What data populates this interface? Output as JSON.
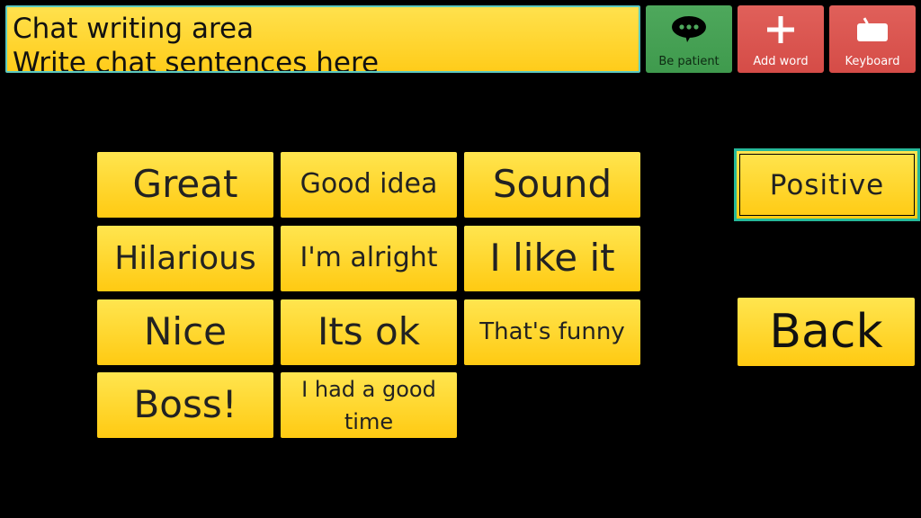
{
  "chat": {
    "title": "Chat writing area",
    "placeholder": "Write chat sentences here"
  },
  "toolbar": {
    "patient_label": "Be patient",
    "add_word_label": "Add word",
    "keyboard_label": "Keyboard",
    "patient_icon": "speech-bubble-dots-icon",
    "add_word_icon": "plus-icon",
    "keyboard_icon": "keyboard-icon",
    "patient_color": "#4ea85c",
    "red_color": "#d54c47"
  },
  "words": [
    "Great",
    "Good idea",
    "Sound",
    "Hilarious",
    "I'm alright",
    "I like it",
    "Nice",
    "Its ok",
    "That's funny",
    "Boss!",
    "I had a good time"
  ],
  "side": {
    "category_label": "Positive",
    "back_label": "Back"
  },
  "colors": {
    "button_yellow": "#ffd21f",
    "selected_border": "#25b89a",
    "background": "#000000"
  }
}
